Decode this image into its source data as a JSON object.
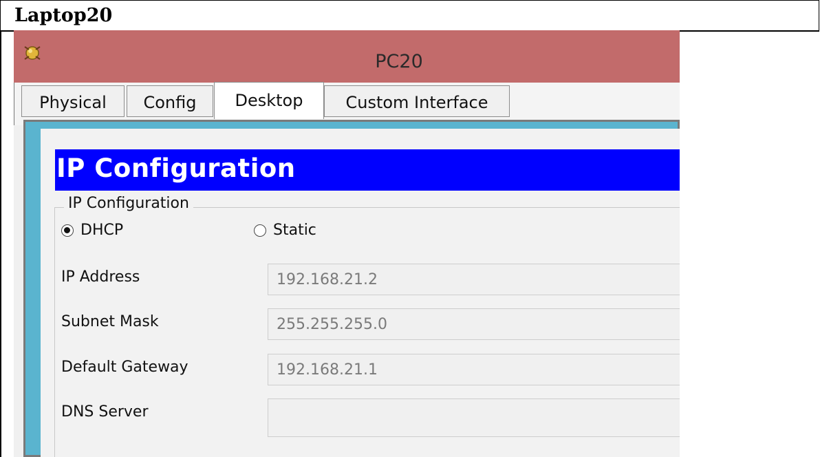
{
  "document": {
    "label": "Laptop20"
  },
  "window": {
    "title": "PC20"
  },
  "tabs": [
    {
      "label": "Physical"
    },
    {
      "label": "Config"
    },
    {
      "label": "Desktop"
    },
    {
      "label": "Custom Interface"
    }
  ],
  "ip_config": {
    "banner": "IP Configuration",
    "group_legend": "IP Configuration",
    "mode_dhcp": "DHCP",
    "mode_static": "Static",
    "selected_mode": "DHCP",
    "ip_label": "IP Address",
    "ip_value": "192.168.21.2",
    "mask_label": "Subnet Mask",
    "mask_value": "255.255.255.0",
    "gateway_label": "Default Gateway",
    "gateway_value": "192.168.21.1",
    "dns_label": "DNS Server",
    "dns_value": ""
  },
  "colors": {
    "titlebar": "#c26b6b",
    "banner": "#0000ff",
    "panel_frame": "#5ab4cf"
  },
  "icons": {
    "app": "packet-tracer-app-icon"
  }
}
